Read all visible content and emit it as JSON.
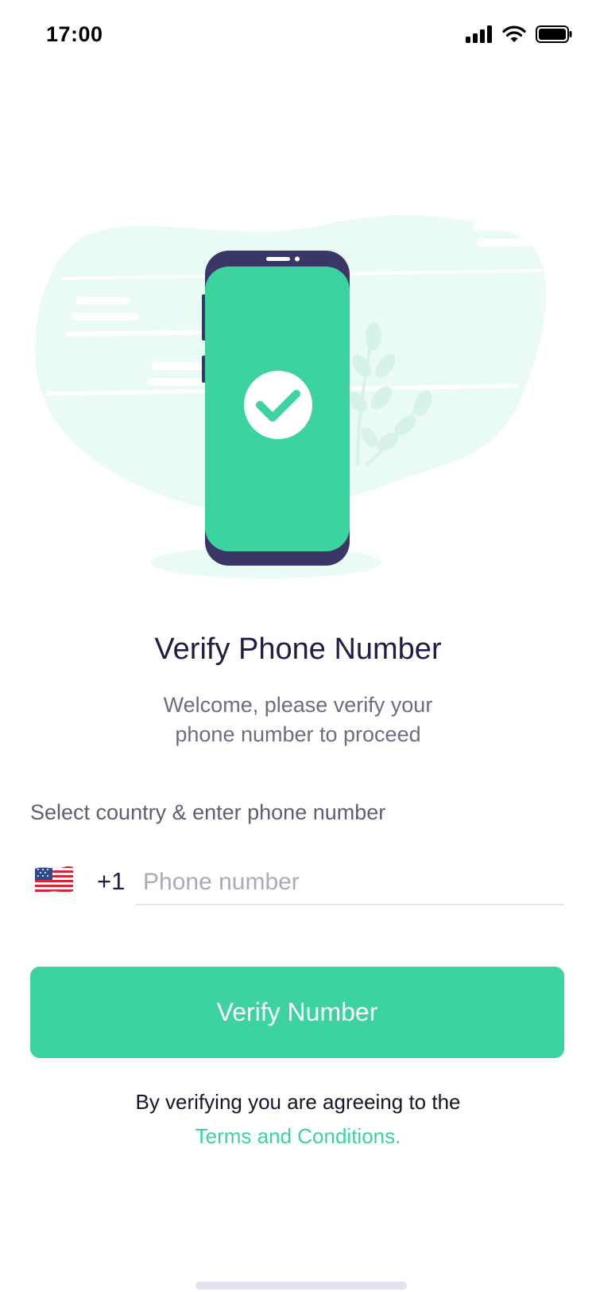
{
  "status_bar": {
    "time": "17:00",
    "icons": [
      "signal-icon",
      "wifi-icon",
      "battery-icon"
    ]
  },
  "illustration": {
    "name": "phone-verified-illustration",
    "icon": "checkmark-icon"
  },
  "header": {
    "title": "Verify Phone Number",
    "subtitle_line1": "Welcome, please verify your",
    "subtitle_line2": "phone number to proceed"
  },
  "form": {
    "country_label": "Select country & enter phone number",
    "country_flag": "us-flag-icon",
    "dial_code": "+1",
    "phone_value": "",
    "phone_placeholder": "Phone number"
  },
  "actions": {
    "verify_label": "Verify Number"
  },
  "footer": {
    "terms_text": "By verifying you are agreeing to the",
    "terms_link": "Terms and Conditions."
  },
  "colors": {
    "accent": "#3cd39e",
    "phone_frame": "#3a3665",
    "blob": "#eafaf4",
    "title": "#1d1f44"
  }
}
